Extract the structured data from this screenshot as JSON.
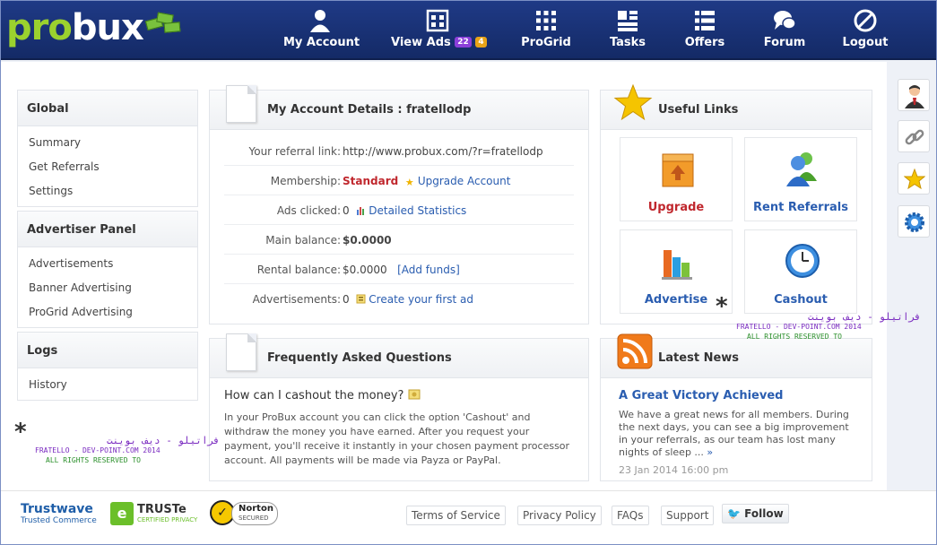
{
  "header": {
    "logo_pro": "pro",
    "logo_bux": "bux",
    "nav": [
      {
        "label": "My Account"
      },
      {
        "label": "View Ads",
        "badge1": "22",
        "badge2": "4"
      },
      {
        "label": "ProGrid"
      },
      {
        "label": "Tasks"
      },
      {
        "label": "Offers"
      },
      {
        "label": "Forum"
      },
      {
        "label": "Logout"
      }
    ]
  },
  "sidebar": {
    "sections": [
      {
        "title": "Global",
        "items": [
          "Summary",
          "Get Referrals",
          "Settings"
        ]
      },
      {
        "title": "Advertiser Panel",
        "items": [
          "Advertisements",
          "Banner Advertising",
          "ProGrid Advertising"
        ]
      },
      {
        "title": "Logs",
        "items": [
          "History"
        ]
      }
    ]
  },
  "account": {
    "title": "My Account Details : fratellodp",
    "rows": [
      {
        "label": "Your referral link:",
        "value": "http://www.probux.com/?r=fratellodp"
      },
      {
        "label": "Membership:",
        "value": "Standard",
        "link": "Upgrade Account"
      },
      {
        "label": "Ads clicked:",
        "value": "0",
        "link": "Detailed Statistics"
      },
      {
        "label": "Main balance:",
        "value": "$0.0000"
      },
      {
        "label": "Rental balance:",
        "value": "$0.0000",
        "link": "[Add funds]"
      },
      {
        "label": "Advertisements:",
        "value": "0",
        "link": "Create your first ad"
      }
    ]
  },
  "faq": {
    "title": "Frequently Asked Questions",
    "question": "How can I cashout the money?",
    "answer": "In your ProBux account you can click the option 'Cashout' and withdraw the money you have earned. After you request your payment, you'll receive it instantly in your chosen payment processor account. All payments will be made via Payza or PayPal."
  },
  "links": {
    "title": "Useful Links",
    "tiles": [
      "Upgrade",
      "Rent Referrals",
      "Advertise",
      "Cashout"
    ]
  },
  "news": {
    "title": "Latest News",
    "headline": "A Great Victory Achieved",
    "body": "We have a great news for all members. During the next days, you can see a big improvement in your referrals, as our team has lost many nights of sleep ...",
    "more": "»",
    "date": "23 Jan 2014 16:00 pm"
  },
  "watermark": {
    "arabic": "فراتيلو - ديف بوينت",
    "line1": "FRATELLO - DEV-POINT.COM 2014",
    "line2": "ALL RIGHTS RESERVED TO"
  },
  "footer": {
    "trustwave": "Trustwave",
    "trustwave_sub": "Trusted Commerce",
    "truste": "TRUSTe",
    "truste_sub": "CERTIFIED PRIVACY",
    "norton": "Norton",
    "norton_sub": "SECURED",
    "links": [
      "Terms of Service",
      "Privacy Policy",
      "FAQs",
      "Support"
    ],
    "follow": "Follow"
  },
  "colors": {
    "accent": "#2a5db0",
    "header": "#1f3a86",
    "green": "#9bd12e",
    "red": "#c0272d"
  }
}
